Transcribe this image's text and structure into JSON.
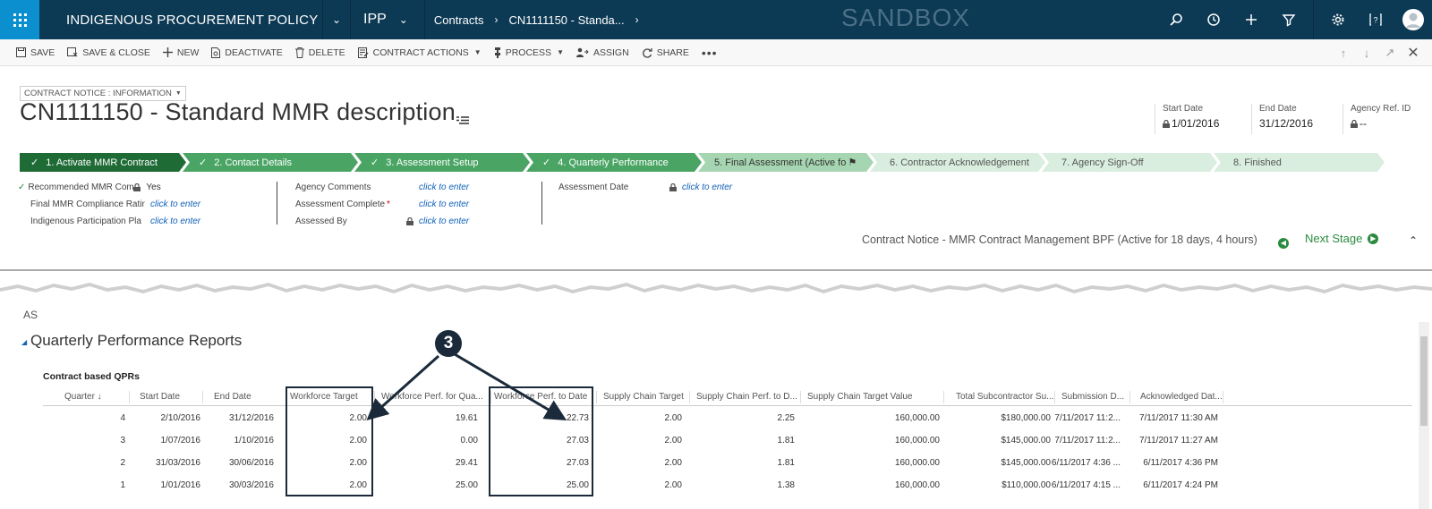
{
  "nav": {
    "app_name": "INDIGENOUS PROCUREMENT POLICY",
    "app_short": "IPP",
    "breadcrumb": [
      "Contracts",
      "CN1111150 - Standa..."
    ],
    "environment": "SANDBOX"
  },
  "commands": [
    {
      "label": "SAVE",
      "icon": "save-icon"
    },
    {
      "label": "SAVE & CLOSE",
      "icon": "save-close-icon"
    },
    {
      "label": "NEW",
      "icon": "plus-icon"
    },
    {
      "label": "DEACTIVATE",
      "icon": "deactivate-icon"
    },
    {
      "label": "DELETE",
      "icon": "trash-icon"
    },
    {
      "label": "CONTRACT ACTIONS",
      "icon": "contract-actions-icon"
    },
    {
      "label": "PROCESS",
      "icon": "process-icon"
    },
    {
      "label": "ASSIGN",
      "icon": "assign-icon"
    },
    {
      "label": "SHARE",
      "icon": "share-icon"
    }
  ],
  "header": {
    "form_selector": "CONTRACT NOTICE : INFORMATION",
    "title": "CN1111150 - Standard MMR description",
    "start_date_label": "Start Date",
    "start_date": "1/01/2016",
    "end_date_label": "End Date",
    "end_date": "31/12/2016",
    "agency_ref_label": "Agency Ref. ID",
    "agency_ref": "--"
  },
  "stages": [
    {
      "label": "1. Activate MMR Contract",
      "status": "done"
    },
    {
      "label": "2. Contact Details",
      "status": "done"
    },
    {
      "label": "3. Assessment Setup",
      "status": "done"
    },
    {
      "label": "4. Quarterly Performance",
      "status": "done"
    },
    {
      "label": "5. Final Assessment (Active fo",
      "status": "active"
    },
    {
      "label": "6. Contractor Acknowledgement",
      "status": "future"
    },
    {
      "label": "7. Agency Sign-Off",
      "status": "future"
    },
    {
      "label": "8. Finished",
      "status": "future"
    }
  ],
  "stage_fields": {
    "col1": [
      {
        "label": "Recommended MMR Comp",
        "value": "Yes"
      },
      {
        "label": "Final MMR Compliance Ratir",
        "value": "click to enter"
      },
      {
        "label": "Indigenous Participation Pla",
        "value": "click to enter"
      }
    ],
    "col2": [
      {
        "label": "Agency Comments",
        "value": "click to enter"
      },
      {
        "label": "Assessment Complete",
        "value": "click to enter"
      },
      {
        "label": "Assessed By",
        "value": "click to enter"
      }
    ],
    "col3": [
      {
        "label": "Assessment Date",
        "value": "click to enter"
      }
    ]
  },
  "bpf": {
    "status": "Contract Notice - MMR Contract Management BPF (Active for 18 days, 4 hours)",
    "next_stage": "Next Stage"
  },
  "section": {
    "partial": "AS",
    "title": "Quarterly Performance Reports",
    "grid_title": "Contract based QPRs",
    "callout_number": "3"
  },
  "grid": {
    "columns": [
      "Quarter ↓",
      "Start Date",
      "End Date",
      "Workforce Target",
      "Workforce Perf. for Qua...",
      "Workforce Perf. to Date",
      "Supply Chain Target",
      "Supply Chain Perf. to D...",
      "Supply Chain Target Value",
      "Total Subcontractor Su...",
      "Submission D...",
      "Acknowledged Dat..."
    ],
    "rows": [
      [
        "4",
        "2/10/2016",
        "31/12/2016",
        "2.00",
        "19.61",
        "22.73",
        "2.00",
        "2.25",
        "160,000.00",
        "$180,000.00",
        "7/11/2017 11:2...",
        "7/11/2017 11:30 AM"
      ],
      [
        "3",
        "1/07/2016",
        "1/10/2016",
        "2.00",
        "0.00",
        "27.03",
        "2.00",
        "1.81",
        "160,000.00",
        "$145,000.00",
        "7/11/2017 11:2...",
        "7/11/2017 11:27 AM"
      ],
      [
        "2",
        "31/03/2016",
        "30/06/2016",
        "2.00",
        "29.41",
        "27.03",
        "2.00",
        "1.81",
        "160,000.00",
        "$145,000.00",
        "6/11/2017 4:36 ...",
        "6/11/2017 4:36 PM"
      ],
      [
        "1",
        "1/01/2016",
        "30/03/2016",
        "2.00",
        "25.00",
        "25.00",
        "2.00",
        "1.38",
        "160,000.00",
        "$110,000.00",
        "6/11/2017 4:15 ...",
        "6/11/2017 4:24 PM"
      ]
    ]
  },
  "colors": {
    "navbar": "#0c3954",
    "waffle": "#0c8fcf",
    "stage_done": "#4aa564",
    "stage_first": "#1f6b35",
    "stage_active": "#a6d6b1",
    "stage_future": "#d9eede",
    "link": "#1161b9"
  }
}
